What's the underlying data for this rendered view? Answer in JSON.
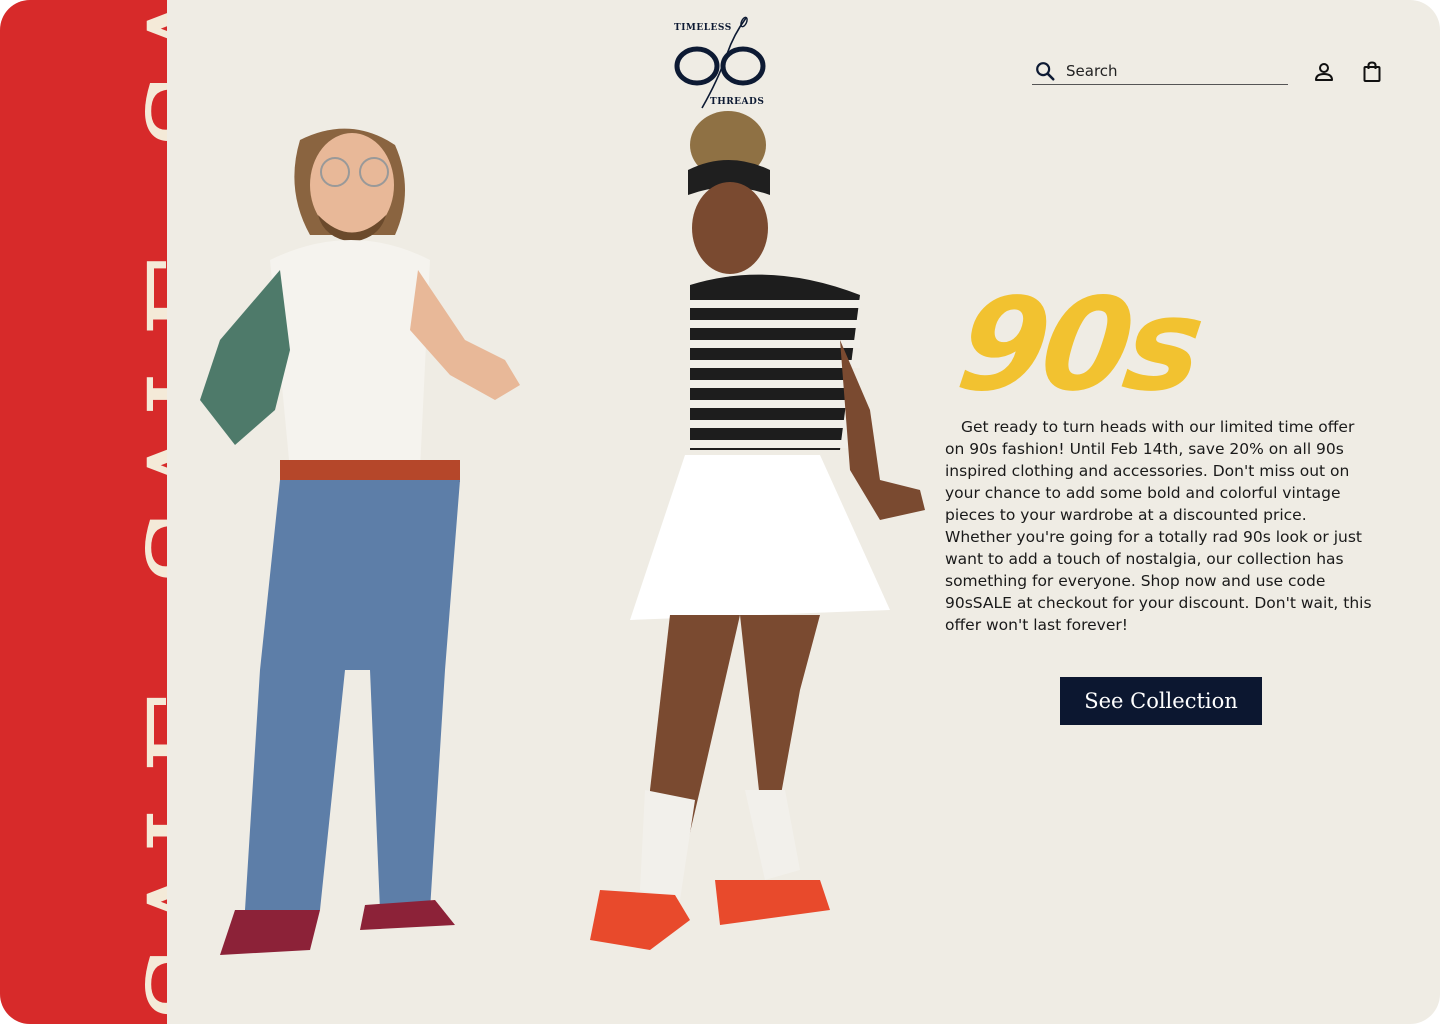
{
  "banner": {
    "words": [
      "SALE",
      "SALE",
      "SALE"
    ],
    "background": "#d72a2a",
    "dot_color": "#f2b71f"
  },
  "brand": {
    "top_text": "TIMELESS",
    "bottom_text": "THREADS",
    "color": "#0d1a33"
  },
  "header": {
    "search_placeholder": "Search",
    "search_icon": "search-icon",
    "account_icon": "user-icon",
    "cart_icon": "shopping-bag-icon"
  },
  "hero": {
    "headline": "90s",
    "headline_color": "#f2c230",
    "description": "Get ready to turn heads with our limited time offer on 90s fashion! Until Feb 14th, save 20% on all 90s inspired clothing and accessories. Don't miss out on your chance to add some bold and colorful vintage pieces to your wardrobe at a discounted price. Whether you're going for a totally rad 90s look or just want to add a touch of nostalgia, our collection has something for everyone. Shop now and use code 90sSALE at checkout for your discount. Don't wait, this offer won't last forever!",
    "cta_label": "See Collection",
    "cta_color": "#0c1730"
  }
}
